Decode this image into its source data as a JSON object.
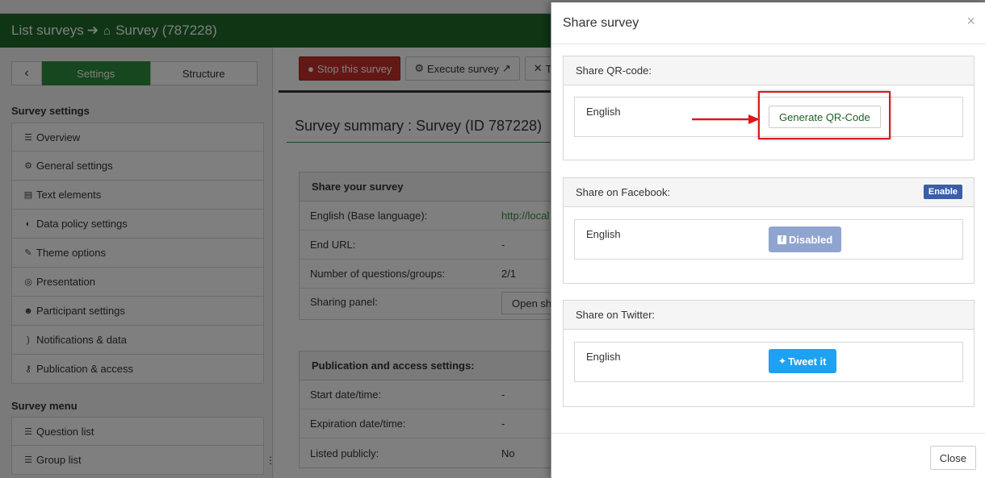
{
  "header": {
    "breadcrumb_list": "List surveys",
    "breadcrumb_survey": "Survey (787228)"
  },
  "sidebar": {
    "tabs": [
      {
        "label": "Settings",
        "active": true
      },
      {
        "label": "Structure",
        "active": false
      }
    ],
    "settings_heading": "Survey settings",
    "settings_items": [
      {
        "label": "Overview",
        "icon": "list-icon"
      },
      {
        "label": "General settings",
        "icon": "gears-icon"
      },
      {
        "label": "Text elements",
        "icon": "file-text-icon"
      },
      {
        "label": "Data policy settings",
        "icon": "shield-icon"
      },
      {
        "label": "Theme options",
        "icon": "paintbrush-icon"
      },
      {
        "label": "Presentation",
        "icon": "eye-slash-icon"
      },
      {
        "label": "Participant settings",
        "icon": "users-icon"
      },
      {
        "label": "Notifications & data",
        "icon": "rss-icon"
      },
      {
        "label": "Publication & access",
        "icon": "key-icon"
      }
    ],
    "menu_heading": "Survey menu",
    "menu_items": [
      {
        "label": "Question list",
        "icon": "list-icon"
      },
      {
        "label": "Group list",
        "icon": "list-icon"
      }
    ]
  },
  "toolbar": {
    "stop_label": "Stop this survey",
    "execute_label": "Execute survey",
    "tools_label": "T"
  },
  "summary": {
    "title": "Survey summary : Survey (ID 787228)",
    "share_panel": {
      "heading": "Share your survey",
      "rows": [
        {
          "label": "English (Base language):",
          "value": "http://local"
        },
        {
          "label": "End URL:",
          "value": "-"
        },
        {
          "label": "Number of questions/groups:",
          "value": "2/1"
        },
        {
          "label": "Sharing panel:",
          "value": "Open sh"
        }
      ]
    },
    "publication_panel": {
      "heading": "Publication and access settings:",
      "rows": [
        {
          "label": "Start date/time:",
          "value": "-"
        },
        {
          "label": "Expiration date/time:",
          "value": "-"
        },
        {
          "label": "Listed publicly:",
          "value": "No"
        }
      ]
    }
  },
  "modal": {
    "title": "Share survey",
    "close_x": "×",
    "qr": {
      "heading": "Share QR-code:",
      "language": "English",
      "button": "Generate QR-Code"
    },
    "facebook": {
      "heading": "Share on Facebook:",
      "badge": "Enable",
      "language": "English",
      "button": "Disabled"
    },
    "twitter": {
      "heading": "Share on Twitter:",
      "language": "English",
      "button": "Tweet it"
    },
    "close_button": "Close"
  },
  "colors": {
    "brand_green": "#1f6b2b",
    "active_tab": "#2f8f3f",
    "danger": "#c9302c",
    "facebook_disabled": "#8fa4cf",
    "twitter": "#1da1f2",
    "highlight_red": "#d9191c"
  }
}
